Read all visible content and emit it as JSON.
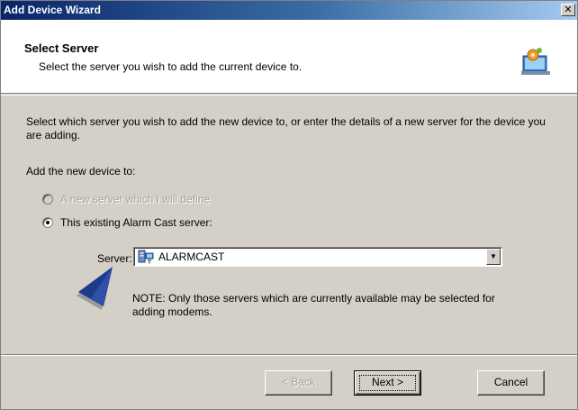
{
  "window": {
    "title": "Add Device Wizard",
    "close_label": "✕"
  },
  "header": {
    "title": "Select Server",
    "subtitle": "Select the server you wish to add the current device to.",
    "icon": "computer-settings-icon"
  },
  "body": {
    "intro": "Select which server you wish to add the new device to, or enter the details of a new server for the device you are adding.",
    "add_label": "Add the new device to:",
    "options": [
      {
        "label": "A new server which I will define",
        "selected": false,
        "disabled": true
      },
      {
        "label": "This existing Alarm Cast server:",
        "selected": true,
        "disabled": false
      }
    ],
    "server": {
      "label": "Server:",
      "value": "ALARMCAST",
      "icon": "server-network-icon"
    },
    "note": "NOTE: Only those servers which are currently available may be selected for adding modems.",
    "note_icon": "pointer-arrow-icon"
  },
  "buttons": {
    "back": "< Back",
    "next": "Next >",
    "cancel": "Cancel"
  },
  "colors": {
    "title_bar_start": "#0a246a",
    "title_bar_end": "#a6caf0",
    "face": "#d4d0c8",
    "note_arrow": "#1e3a8a"
  }
}
